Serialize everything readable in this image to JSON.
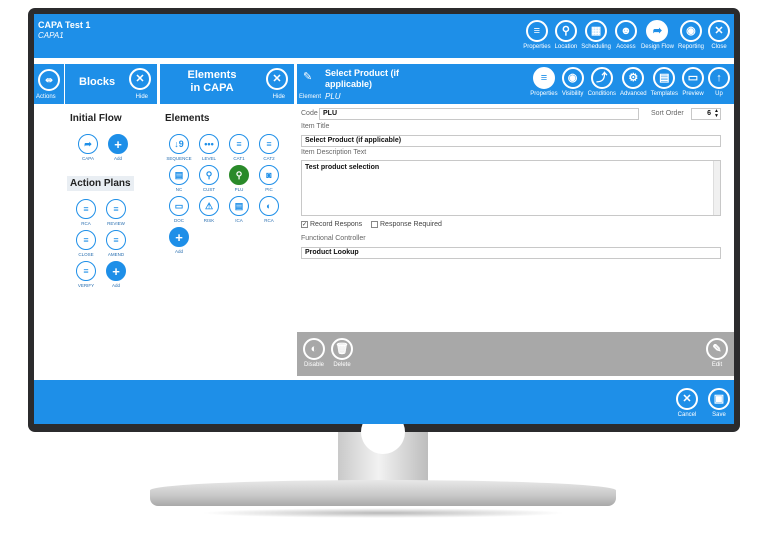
{
  "app": {
    "title": "CAPA Test 1",
    "subtitle": "CAPA1"
  },
  "toolbar": {
    "items": [
      {
        "label": "Properties",
        "icon": "list-icon"
      },
      {
        "label": "Location",
        "icon": "location-icon"
      },
      {
        "label": "Scheduling",
        "icon": "scheduling-icon"
      },
      {
        "label": "Access",
        "icon": "users-icon"
      },
      {
        "label": "Design Flow",
        "icon": "design-flow-icon"
      },
      {
        "label": "Reporting",
        "icon": "eye-icon"
      },
      {
        "label": "Close",
        "icon": "close-icon"
      }
    ]
  },
  "actions_label": "Actions",
  "blocks": {
    "title": "Blocks",
    "hide_label": "Hide",
    "initial_flow_title": "Initial Flow",
    "initial_flow": [
      {
        "label": "CAPA",
        "icon": "share-icon"
      },
      {
        "label": "Add",
        "icon": "plus-icon"
      }
    ],
    "action_plans_title": "Action Plans",
    "action_plans": [
      {
        "label": "RCA",
        "icon": "list-icon"
      },
      {
        "label": "REVIEW",
        "icon": "list-icon"
      },
      {
        "label": "CLOSE",
        "icon": "list-icon"
      },
      {
        "label": "AMEND",
        "icon": "list-icon"
      },
      {
        "label": "VERIFY",
        "icon": "list-icon"
      },
      {
        "label": "Add",
        "icon": "plus-icon"
      }
    ]
  },
  "elements": {
    "title": "Elements in CAPA",
    "hide_label": "Hide",
    "section_title": "Elements",
    "items": [
      {
        "label": "SEQUENCE",
        "icon": "sequence-icon"
      },
      {
        "label": "LEVEL",
        "icon": "dots-icon"
      },
      {
        "label": "CAT1",
        "icon": "list-icon"
      },
      {
        "label": "CAT2",
        "icon": "list-icon"
      },
      {
        "label": "NC",
        "icon": "folder-icon"
      },
      {
        "label": "CUST",
        "icon": "search-icon"
      },
      {
        "label": "PLU",
        "icon": "search-icon",
        "selected": true
      },
      {
        "label": "PIC",
        "icon": "camera-icon"
      },
      {
        "label": "DOC",
        "icon": "document-icon"
      },
      {
        "label": "RISK",
        "icon": "warning-icon"
      },
      {
        "label": "ICA",
        "icon": "folder-icon"
      },
      {
        "label": "RCA",
        "icon": "toggle-icon"
      },
      {
        "label": "Add",
        "icon": "plus-icon"
      }
    ]
  },
  "element_header": {
    "title": "Select Product (if applicable)",
    "prefix": "Element",
    "code": "PLU",
    "tools": [
      {
        "label": "Properties",
        "icon": "list-icon"
      },
      {
        "label": "Visibility",
        "icon": "eye-icon"
      },
      {
        "label": "Conditions",
        "icon": "conditions-icon"
      },
      {
        "label": "Advanced",
        "icon": "gears-icon"
      },
      {
        "label": "Templates",
        "icon": "templates-icon"
      },
      {
        "label": "Preview",
        "icon": "preview-icon"
      },
      {
        "label": "Up",
        "icon": "arrow-up-icon"
      }
    ]
  },
  "form": {
    "code_label": "Code",
    "code_value": "PLU",
    "sort_order_label": "Sort Order",
    "sort_order_value": "6",
    "item_title_label": "Item Title",
    "item_title_value": "Select Product (if applicable)",
    "item_description_label": "Item Description Text",
    "item_description_value": "Test product selection",
    "record_response_label": "Record Respons",
    "record_response_checked": true,
    "response_required_label": "Response Required",
    "response_required_checked": false,
    "functional_controller_label": "Functional Controller",
    "functional_controller_value": "Product Lookup"
  },
  "actionbar": {
    "disable_label": "Disable",
    "delete_label": "Delete",
    "edit_label": "Edit"
  },
  "footer": {
    "cancel_label": "Cancel",
    "save_label": "Save"
  }
}
